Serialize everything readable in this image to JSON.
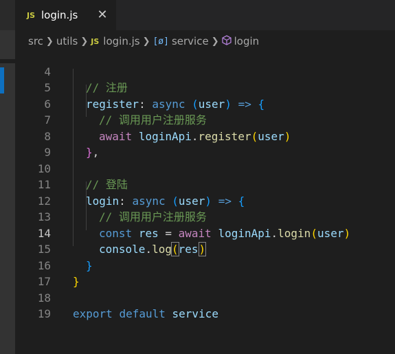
{
  "tab": {
    "icon": "JS",
    "filename": "login.js",
    "close": "✕"
  },
  "breadcrumb": {
    "folder1": "src",
    "folder2": "utils",
    "file_icon": "JS",
    "file": "login.js",
    "object_icon": "[ø]",
    "object": "service",
    "method": "login"
  },
  "editor": {
    "current_line": "14",
    "lines": [
      {
        "n": "4",
        "tokens": [
          "// 注册"
        ]
      },
      {
        "n": "5",
        "tokens": [
          "register",
          ": ",
          "async",
          " ",
          "(",
          "user",
          ")",
          " ",
          "=>",
          " ",
          "{"
        ]
      },
      {
        "n": "6",
        "tokens": [
          "// 调用用户注册服务"
        ]
      },
      {
        "n": "7",
        "tokens": [
          "await",
          " ",
          "loginApi",
          ".",
          "register",
          "(",
          "user",
          ")"
        ]
      },
      {
        "n": "8",
        "tokens": [
          "}",
          ","
        ]
      },
      {
        "n": "9",
        "tokens": []
      },
      {
        "n": "10",
        "tokens": [
          "// 登陆"
        ]
      },
      {
        "n": "11",
        "tokens": [
          "login",
          ": ",
          "async",
          " ",
          "(",
          "user",
          ")",
          " ",
          "=>",
          " ",
          "{"
        ]
      },
      {
        "n": "12",
        "tokens": [
          "// 调用用户注册服务"
        ]
      },
      {
        "n": "13",
        "tokens": [
          "const",
          " ",
          "res",
          " = ",
          "await",
          " ",
          "loginApi",
          ".",
          "login",
          "(",
          "user",
          ")"
        ]
      },
      {
        "n": "14",
        "tokens": [
          "console",
          ".",
          "log",
          "(",
          "res",
          ")"
        ]
      },
      {
        "n": "15",
        "tokens": [
          "}"
        ]
      },
      {
        "n": "16",
        "tokens": [
          "}"
        ]
      },
      {
        "n": "17",
        "tokens": []
      },
      {
        "n": "18",
        "tokens": [
          "export",
          " ",
          "default",
          " ",
          "service"
        ]
      },
      {
        "n": "19",
        "tokens": []
      }
    ]
  }
}
